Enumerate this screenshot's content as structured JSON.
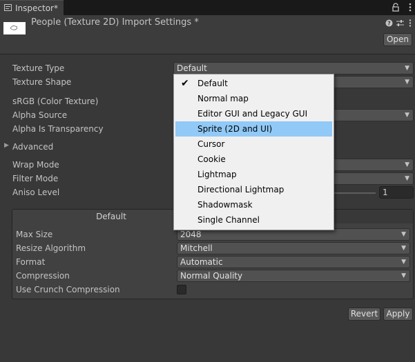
{
  "tab": {
    "label": "Inspector*",
    "icon": "info-icon"
  },
  "tab_actions": {
    "lock": "lock-icon",
    "settings": "sliders-icon",
    "menu": "kebab-icon"
  },
  "header": {
    "title": "People (Texture 2D) Import Settings *",
    "help_icon": "help-icon",
    "settings_icon": "sliders-icon",
    "menu_icon": "kebab-icon",
    "open_label": "Open"
  },
  "properties": {
    "texture_type_label": "Texture Type",
    "texture_type_value": "Default",
    "texture_shape_label": "Texture Shape",
    "srgb_label": "sRGB (Color Texture)",
    "alpha_source_label": "Alpha Source",
    "alpha_transparency_label": "Alpha Is Transparency",
    "advanced_label": "Advanced",
    "wrap_mode_label": "Wrap Mode",
    "filter_mode_label": "Filter Mode",
    "aniso_level_label": "Aniso Level",
    "aniso_level_value": "1"
  },
  "platform": {
    "tab_label": "Default",
    "max_size_label": "Max Size",
    "max_size_value": "2048",
    "resize_label": "Resize Algorithm",
    "resize_value": "Mitchell",
    "format_label": "Format",
    "format_value": "Automatic",
    "compression_label": "Compression",
    "compression_value": "Normal Quality",
    "crunch_label": "Use Crunch Compression",
    "crunch_checked": false
  },
  "buttons": {
    "revert": "Revert",
    "apply": "Apply"
  },
  "dropdown": {
    "checked": "Default",
    "highlighted": "Sprite (2D and UI)",
    "options": [
      "Default",
      "Normal map",
      "Editor GUI and Legacy GUI",
      "Sprite (2D and UI)",
      "Cursor",
      "Cookie",
      "Lightmap",
      "Directional Lightmap",
      "Shadowmask",
      "Single Channel"
    ]
  },
  "colors": {
    "panel": "#383838",
    "highlight": "#91c9f7",
    "menu_bg": "#f0f0f0"
  }
}
